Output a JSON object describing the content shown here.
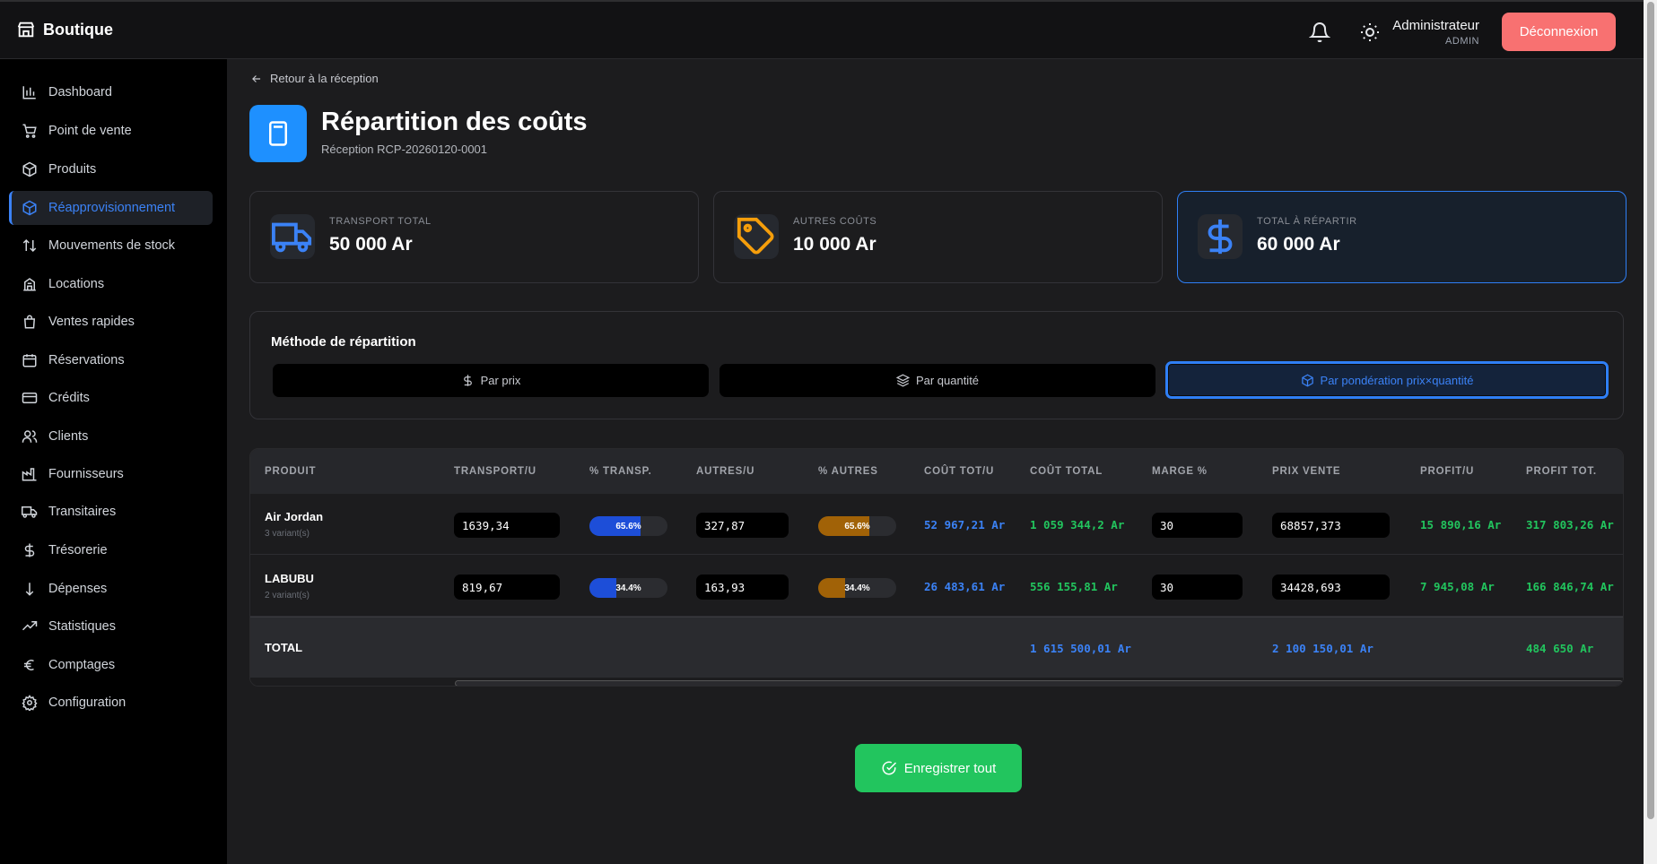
{
  "header": {
    "brand": "Boutique",
    "user_name": "Administrateur",
    "user_role": "ADMIN",
    "logout_label": "Déconnexion"
  },
  "sidebar": {
    "items": [
      {
        "label": "Dashboard",
        "icon": "chart-icon"
      },
      {
        "label": "Point de vente",
        "icon": "cart-icon"
      },
      {
        "label": "Produits",
        "icon": "box-icon"
      },
      {
        "label": "Réapprovisionnement",
        "icon": "box-icon",
        "active": true
      },
      {
        "label": "Mouvements de stock",
        "icon": "arrows-icon"
      },
      {
        "label": "Locations",
        "icon": "building-icon"
      },
      {
        "label": "Ventes rapides",
        "icon": "bag-icon"
      },
      {
        "label": "Réservations",
        "icon": "calendar-icon"
      },
      {
        "label": "Crédits",
        "icon": "credit-card-icon"
      },
      {
        "label": "Clients",
        "icon": "users-icon"
      },
      {
        "label": "Fournisseurs",
        "icon": "factory-icon"
      },
      {
        "label": "Transitaires",
        "icon": "truck-icon"
      },
      {
        "label": "Trésorerie",
        "icon": "dollar-icon"
      },
      {
        "label": "Dépenses",
        "icon": "arrow-down-icon"
      },
      {
        "label": "Statistiques",
        "icon": "trending-up-icon"
      },
      {
        "label": "Comptages",
        "icon": "euro-icon"
      },
      {
        "label": "Configuration",
        "icon": "gear-icon"
      }
    ]
  },
  "page": {
    "back_label": "Retour à la réception",
    "title": "Répartition des coûts",
    "subtitle": "Réception RCP-20260120-0001"
  },
  "cards": [
    {
      "label": "TRANSPORT TOTAL",
      "value": "50 000 Ar",
      "color": "#3b82f6"
    },
    {
      "label": "AUTRES COÛTS",
      "value": "10 000 Ar",
      "color": "#f59e0b"
    },
    {
      "label": "TOTAL À RÉPARTIR",
      "value": "60 000 Ar",
      "color": "#3b82f6"
    }
  ],
  "method": {
    "title": "Méthode de répartition",
    "options": [
      "Par prix",
      "Par quantité",
      "Par pondération prix×quantité"
    ],
    "selected": "Par pondération prix×quantité"
  },
  "table": {
    "headers": [
      "PRODUIT",
      "TRANSPORT/U",
      "% TRANSP.",
      "AUTRES/U",
      "% AUTRES",
      "COÛT TOT/U",
      "COÛT TOTAL",
      "MARGE %",
      "PRIX VENTE",
      "PROFIT/U",
      "PROFIT TOT."
    ],
    "rows": [
      {
        "product": "Air Jordan",
        "variants": "3 variant(s)",
        "transport_u": "1639,34",
        "transp_pct": "65.6%",
        "transp_frac": 0.656,
        "autres_u": "327,87",
        "autres_pct": "65.6%",
        "autres_frac": 0.656,
        "cout_tot_u": "52 967,21 Ar",
        "cout_total": "1 059 344,2 Ar",
        "marge": "30",
        "prix_vente": "68857,373",
        "profit_u": "15 890,16 Ar",
        "profit_tot": "317 803,26 Ar"
      },
      {
        "product": "LABUBU",
        "variants": "2 variant(s)",
        "transport_u": "819,67",
        "transp_pct": "34.4%",
        "transp_frac": 0.344,
        "autres_u": "163,93",
        "autres_pct": "34.4%",
        "autres_frac": 0.344,
        "cout_tot_u": "26 483,61 Ar",
        "cout_total": "556 155,81 Ar",
        "marge": "30",
        "prix_vente": "34428,693",
        "profit_u": "7 945,08 Ar",
        "profit_tot": "166 846,74 Ar"
      }
    ],
    "total": {
      "label": "TOTAL",
      "cout_total": "1 615 500,01 Ar",
      "prix_vente": "2 100 150,01 Ar",
      "profit_tot": "484 650 Ar"
    }
  },
  "save_label": "Enregistrer tout"
}
